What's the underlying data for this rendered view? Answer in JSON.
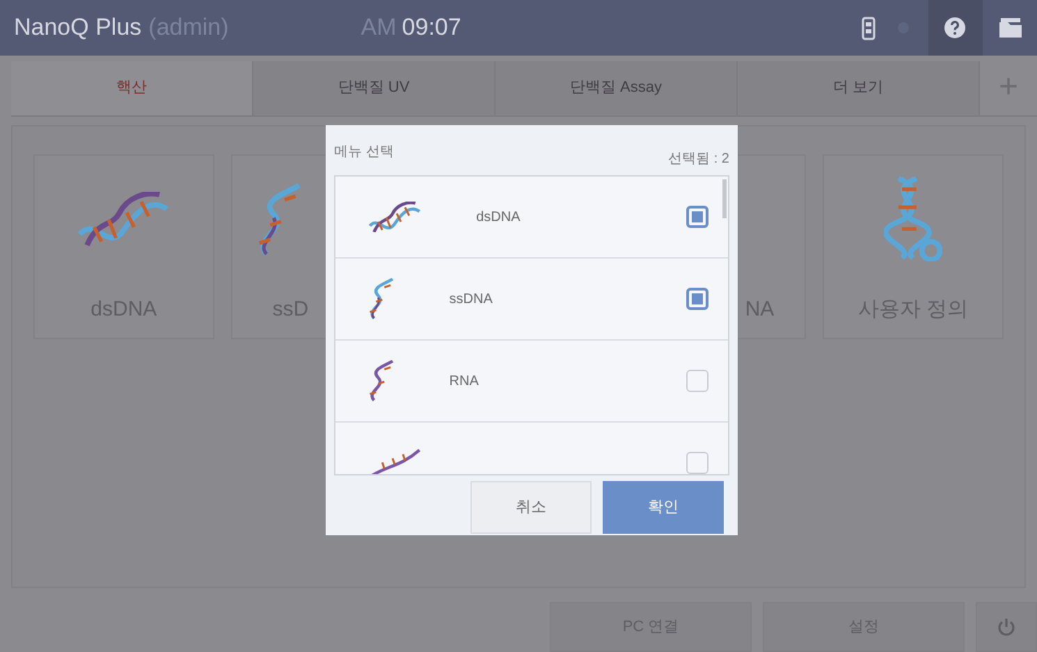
{
  "top_bar": {
    "title": "NanoQ Plus",
    "user": "(admin)",
    "time_prefix": "AM",
    "time": "09:07"
  },
  "tabs": [
    {
      "label": "핵산",
      "selected": true
    },
    {
      "label": "단백질 UV",
      "selected": false
    },
    {
      "label": "단백질 Assay",
      "selected": false
    },
    {
      "label": "더 보기",
      "selected": false
    }
  ],
  "add_tab": "+",
  "cards": [
    {
      "label": "dsDNA"
    },
    {
      "label": "ssD"
    },
    {
      "label": "NA"
    },
    {
      "label": "사용자 정의"
    }
  ],
  "dialog": {
    "title": "메뉴 선택",
    "count": "선택됨 : 2",
    "items": [
      {
        "label": "dsDNA",
        "checked": true
      },
      {
        "label": "ssDNA",
        "checked": true
      },
      {
        "label": "RNA",
        "checked": false
      },
      {
        "checked": false
      }
    ],
    "buttons": [
      {
        "label": "취소",
        "kind": "cancel"
      },
      {
        "label": "확인",
        "kind": "confirm"
      }
    ]
  },
  "bottom_buttons": [
    "PC 연결",
    "설정"
  ]
}
